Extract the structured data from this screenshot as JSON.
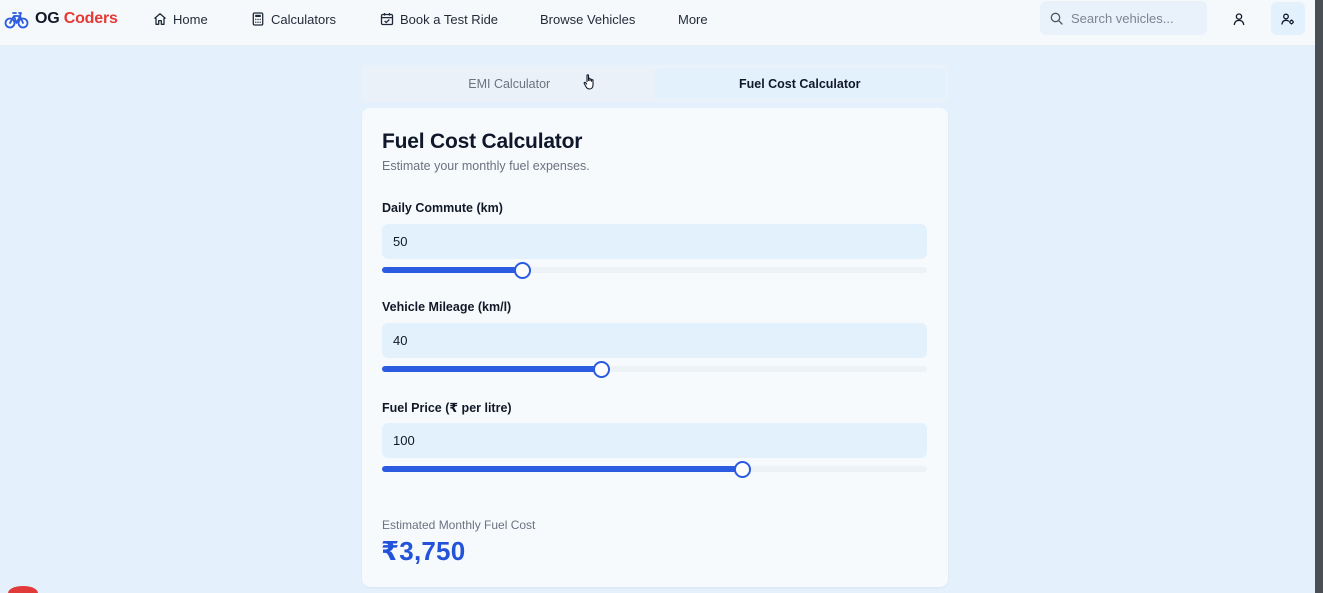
{
  "app": {
    "logo_part1": "OG",
    "logo_part2": "Coders"
  },
  "nav": {
    "items": [
      {
        "label": "Home",
        "icon": "home-icon"
      },
      {
        "label": "Calculators",
        "icon": "calculator-icon"
      },
      {
        "label": "Book a Test Ride",
        "icon": "calendar-icon"
      },
      {
        "label": "Browse Vehicles",
        "icon": ""
      },
      {
        "label": "More",
        "icon": ""
      }
    ],
    "search_placeholder": "Search vehicles...",
    "account_icon": "user-icon",
    "profile_settings_icon": "user-settings-icon"
  },
  "tabs": [
    {
      "label": "EMI Calculator",
      "active": false
    },
    {
      "label": "Fuel Cost Calculator",
      "active": true
    }
  ],
  "calculator": {
    "title": "Fuel Cost Calculator",
    "subtitle": "Estimate your monthly fuel expenses.",
    "fields": [
      {
        "label": "Daily Commute (km)",
        "value": "50",
        "slider_fraction": 0.256
      },
      {
        "label": "Vehicle Mileage (km/l)",
        "value": "40",
        "slider_fraction": 0.402
      },
      {
        "label": "Fuel Price (₹ per litre)",
        "value": "100",
        "slider_fraction": 0.66
      }
    ],
    "result_label": "Estimated Monthly Fuel Cost",
    "result_value": "₹3,750"
  },
  "colors": {
    "accent": "#2b5be0",
    "result": "#2353d8",
    "brand_red": "#e53935",
    "page_bg": "#e4f1fd"
  }
}
